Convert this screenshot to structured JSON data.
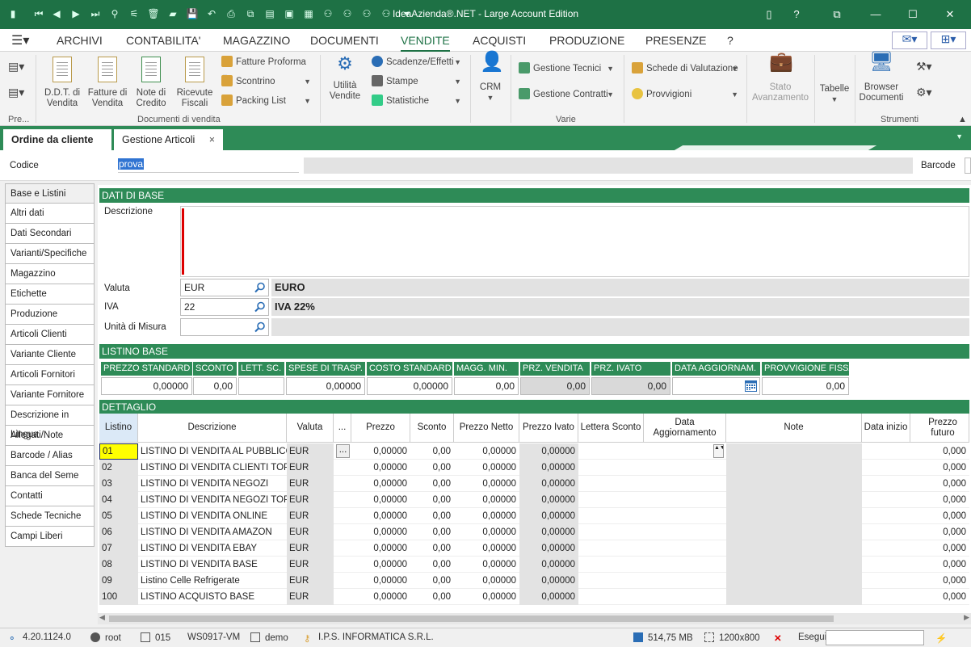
{
  "window": {
    "title": "IdeaAzienda®.NET - Large Account Edition"
  },
  "menu": [
    "ARCHIVI",
    "CONTABILITA'",
    "MAGAZZINO",
    "DOCUMENTI",
    "VENDITE",
    "ACQUISTI",
    "PRODUZIONE",
    "PRESENZE",
    "?"
  ],
  "menu_active": "VENDITE",
  "ribbon": {
    "pre_label": "Pre...",
    "ddt": "D.D.T. di\nVendita",
    "fatture": "Fatture di\nVendita",
    "note": "Note di\nCredito",
    "ricevute": "Ricevute\nFiscali",
    "fatture_proforma": "Fatture Proforma",
    "scontrino": "Scontrino",
    "packing": "Packing List",
    "group_docs": "Documenti di vendita",
    "utilita": "Utilità\nVendite",
    "scadenze": "Scadenze/Effetti",
    "stampe": "Stampe",
    "statistiche": "Statistiche",
    "crm": "CRM",
    "gestione_tecnici": "Gestione Tecnici",
    "gestione_contratti": "Gestione Contratti",
    "schede_valutazione": "Schede di Valutazione",
    "provvigioni": "Provvigioni",
    "stato": "Stato\nAvanzamento",
    "group_varie": "Varie",
    "tabelle": "Tabelle",
    "browser": "Browser\nDocumenti",
    "group_strumenti": "Strumenti"
  },
  "tabs": {
    "t1": "Ordine da cliente",
    "t2": "Gestione Articoli"
  },
  "codice": {
    "label": "Codice",
    "value": "prova",
    "barcode_label": "Barcode"
  },
  "nav": [
    "Base e Listini",
    "Altri dati",
    "Dati Secondari",
    "Varianti/Specifiche",
    "Magazzino",
    "Etichette",
    "Produzione",
    "Articoli Clienti",
    "Variante Cliente",
    "Articoli Fornitori",
    "Variante Fornitore",
    "Descrizione in Lingua",
    "Allegati/Note",
    "Barcode / Alias",
    "Banca del Seme",
    "Contatti",
    "Schede Tecniche",
    "Campi Liberi"
  ],
  "dati_base": {
    "header": "DATI DI BASE",
    "descrizione_label": "Descrizione",
    "valuta_label": "Valuta",
    "valuta_value": "EUR",
    "valuta_info": "EURO",
    "iva_label": "IVA",
    "iva_value": "22",
    "iva_info": "IVA 22%",
    "um_label": "Unità di Misura"
  },
  "listino_base": {
    "header": "LISTINO BASE",
    "cols": [
      "PREZZO STANDARD",
      "SCONTO",
      "LETT. SC.",
      "SPESE DI TRASP.",
      "COSTO STANDARD",
      "MAGG. MIN.",
      "PRZ. VENDITA",
      "PRZ. IVATO",
      "DATA AGGIORNAM.",
      "PROVVIGIONE FISSA"
    ],
    "values": [
      "0,00000",
      "0,00",
      "",
      "0,00000",
      "0,00000",
      "0,00",
      "0,00",
      "0,00",
      "",
      "0,00"
    ]
  },
  "dettaglio": {
    "header": "DETTAGLIO",
    "cols": [
      "Listino",
      "Descrizione",
      "Valuta",
      "...",
      "Prezzo",
      "Sconto",
      "Prezzo Netto",
      "Prezzo Ivato",
      "Lettera Sconto",
      "Data\nAggiornamento",
      "Note",
      "Data inizio",
      "Prezzo futuro"
    ],
    "rows": [
      [
        "01",
        "LISTINO DI VENDITA AL PUBBLICO",
        "EUR",
        "0,00000",
        "0,00",
        "0,00000",
        "0,00000",
        "0,000"
      ],
      [
        "02",
        "LISTINO DI VENDITA CLIENTI TOP",
        "EUR",
        "0,00000",
        "0,00",
        "0,00000",
        "0,00000",
        "0,000"
      ],
      [
        "03",
        "LISTINO DI VENDITA NEGOZI",
        "EUR",
        "0,00000",
        "0,00",
        "0,00000",
        "0,00000",
        "0,000"
      ],
      [
        "04",
        "LISTINO DI VENDITA NEGOZI TOP",
        "EUR",
        "0,00000",
        "0,00",
        "0,00000",
        "0,00000",
        "0,000"
      ],
      [
        "05",
        "LISTINO DI VENDITA ONLINE",
        "EUR",
        "0,00000",
        "0,00",
        "0,00000",
        "0,00000",
        "0,000"
      ],
      [
        "06",
        "LISTINO DI VENDITA AMAZON",
        "EUR",
        "0,00000",
        "0,00",
        "0,00000",
        "0,00000",
        "0,000"
      ],
      [
        "07",
        "LISTINO DI VENDITA EBAY",
        "EUR",
        "0,00000",
        "0,00",
        "0,00000",
        "0,00000",
        "0,000"
      ],
      [
        "08",
        "LISTINO DI VENDITA BASE",
        "EUR",
        "0,00000",
        "0,00",
        "0,00000",
        "0,00000",
        "0,000"
      ],
      [
        "09",
        "Listino Celle Refrigerate",
        "EUR",
        "0,00000",
        "0,00",
        "0,00000",
        "0,00000",
        "0,000"
      ],
      [
        "100",
        "LISTINO ACQUISTO BASE",
        "EUR",
        "0,00000",
        "0,00",
        "0,00000",
        "0,00000",
        "0,000"
      ]
    ],
    "ellipsis": "..."
  },
  "status": {
    "version": "4.20.1124.0",
    "user": "root",
    "terminal": "015",
    "machine": "WS0917-VM",
    "db": "demo",
    "company": "I.P.S. INFORMATICA S.R.L.",
    "memory": "514,75 MB",
    "resolution": "1200x800",
    "esegui": "Esegui"
  },
  "colors": {
    "accent": "#1e7145",
    "section": "#2e8b57",
    "selection": "#ffff00"
  }
}
